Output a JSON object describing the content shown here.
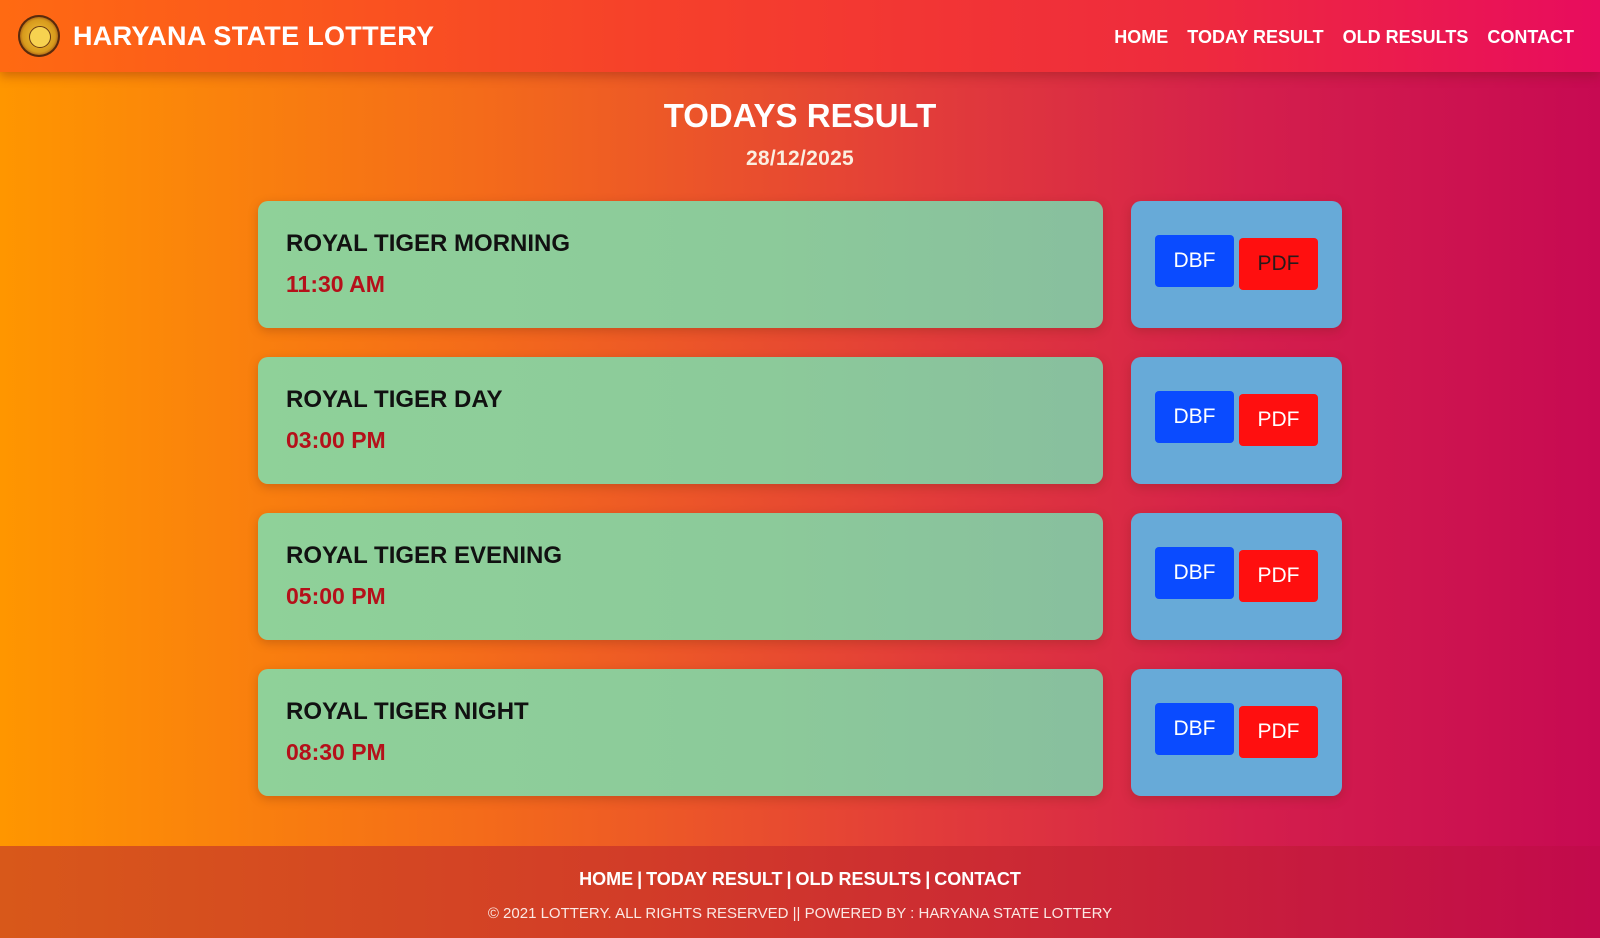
{
  "header": {
    "brand": "HARYANA STATE LOTTERY",
    "logo_icon": "lottery-emblem-icon",
    "nav": [
      {
        "label": "HOME"
      },
      {
        "label": "TODAY RESULT"
      },
      {
        "label": "OLD RESULTS"
      },
      {
        "label": "CONTACT"
      }
    ]
  },
  "main": {
    "title": "TODAYS RESULT",
    "date": "28/12/2025",
    "draws": [
      {
        "name": "ROYAL TIGER MORNING",
        "time": "11:30 AM",
        "dbf_label": "DBF",
        "pdf_label": "PDF"
      },
      {
        "name": "ROYAL TIGER DAY",
        "time": "03:00 PM",
        "dbf_label": "DBF",
        "pdf_label": "PDF"
      },
      {
        "name": "ROYAL TIGER EVENING",
        "time": "05:00 PM",
        "dbf_label": "DBF",
        "pdf_label": "PDF"
      },
      {
        "name": "ROYAL TIGER NIGHT",
        "time": "08:30 PM",
        "dbf_label": "DBF",
        "pdf_label": "PDF"
      }
    ]
  },
  "footer": {
    "links": [
      {
        "label": "HOME"
      },
      {
        "label": "TODAY RESULT"
      },
      {
        "label": "OLD RESULTS"
      },
      {
        "label": "CONTACT"
      }
    ],
    "separator": "|",
    "copyright": "© 2021 LOTTERY. ALL RIGHTS RESERVED || POWERED BY : HARYANA STATE LOTTERY"
  },
  "colors": {
    "card_bg": "#8fd199",
    "actions_bg": "#67aad8",
    "dbf_button": "#0a4bff",
    "pdf_button": "#ff0f0f",
    "time_text": "#b5101a"
  }
}
